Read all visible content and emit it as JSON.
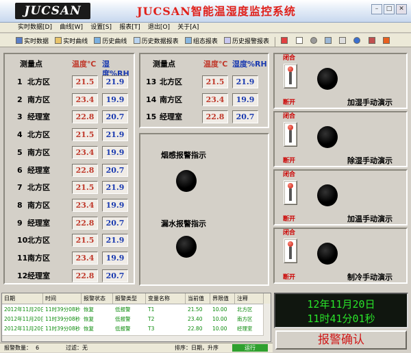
{
  "app": {
    "logo": "JUCSAN",
    "title": "JUCSAN智能温湿度监控系统"
  },
  "menu": [
    "实时数据[D]",
    "曲线[W]",
    "设置[S]",
    "报表[T]",
    "退出[O]",
    "关于[A]"
  ],
  "toolbar": [
    {
      "label": "实时数据",
      "icon": "data-icon"
    },
    {
      "label": "实时曲线",
      "icon": "curve-icon"
    },
    {
      "label": "历史曲线",
      "icon": "history-curve-icon"
    },
    {
      "label": "历史数据报表",
      "icon": "report-icon"
    },
    {
      "label": "组态报表",
      "icon": "config-report-icon"
    },
    {
      "label": "历史报警报表",
      "icon": "alarm-report-icon"
    }
  ],
  "sensors": {
    "headers": {
      "point": "测量点",
      "temp": "温度℃",
      "hum": "湿度%RH"
    },
    "rows": [
      {
        "no": "1",
        "name": "北方区",
        "temp": "21.5",
        "hum": "21.9"
      },
      {
        "no": "2",
        "name": "南方区",
        "temp": "23.4",
        "hum": "19.9"
      },
      {
        "no": "3",
        "name": "经理室",
        "temp": "22.8",
        "hum": "20.7"
      },
      {
        "no": "4",
        "name": "北方区",
        "temp": "21.5",
        "hum": "21.9"
      },
      {
        "no": "5",
        "name": "南方区",
        "temp": "23.4",
        "hum": "19.9"
      },
      {
        "no": "6",
        "name": "经理室",
        "temp": "22.8",
        "hum": "20.7"
      },
      {
        "no": "7",
        "name": "北方区",
        "temp": "21.5",
        "hum": "21.9"
      },
      {
        "no": "8",
        "name": "南方区",
        "temp": "23.4",
        "hum": "19.9"
      },
      {
        "no": "9",
        "name": "经理室",
        "temp": "22.8",
        "hum": "20.7"
      },
      {
        "no": "10",
        "name": "北方区",
        "temp": "21.5",
        "hum": "21.9"
      },
      {
        "no": "11",
        "name": "南方区",
        "temp": "23.4",
        "hum": "19.9"
      },
      {
        "no": "12",
        "name": "经理室",
        "temp": "22.8",
        "hum": "20.7"
      },
      {
        "no": "13",
        "name": "北方区",
        "temp": "21.5",
        "hum": "21.9"
      },
      {
        "no": "14",
        "name": "南方区",
        "temp": "23.4",
        "hum": "19.9"
      },
      {
        "no": "15",
        "name": "经理室",
        "temp": "22.8",
        "hum": "20.7"
      }
    ]
  },
  "indicators": {
    "smoke": "烟感报警指示",
    "water": "漏水报警指示"
  },
  "switches": {
    "on": "闭合",
    "off": "断开",
    "items": [
      "加湿手动演示",
      "除湿手动演示",
      "加温手动演示",
      "制冷手动演示"
    ]
  },
  "alarms": {
    "columns": [
      "日期",
      "时间",
      "报警状态",
      "报警类型",
      "变量名称",
      "当前值",
      "界限值",
      "注释"
    ],
    "rows": [
      [
        "2012年11月20日",
        "11时39分08秒",
        "恢复",
        "低报警",
        "T1",
        "21.50",
        "10.00",
        "北方区"
      ],
      [
        "2012年11月20日",
        "11时39分08秒",
        "恢复",
        "低报警",
        "T2",
        "23.40",
        "10.00",
        "南方区"
      ],
      [
        "2012年11月20日",
        "11时39分08秒",
        "恢复",
        "低报警",
        "T3",
        "22.80",
        "10.00",
        "经理室"
      ]
    ]
  },
  "clock": {
    "date": "12年11月20日",
    "time": "11时41分01秒"
  },
  "ack_button": "报警确认",
  "status": {
    "count_label": "报警数量：",
    "count": "6",
    "filter_label": "过滤：",
    "filter": "无",
    "sort_label": "排序：",
    "sort": "日期，升序",
    "run": "运行"
  },
  "colors": {
    "temp": "#c0392b",
    "hum": "#1a3ab0",
    "title": "#e0201a",
    "clock": "#29e329",
    "alarm_text": "#0a8a0a"
  }
}
